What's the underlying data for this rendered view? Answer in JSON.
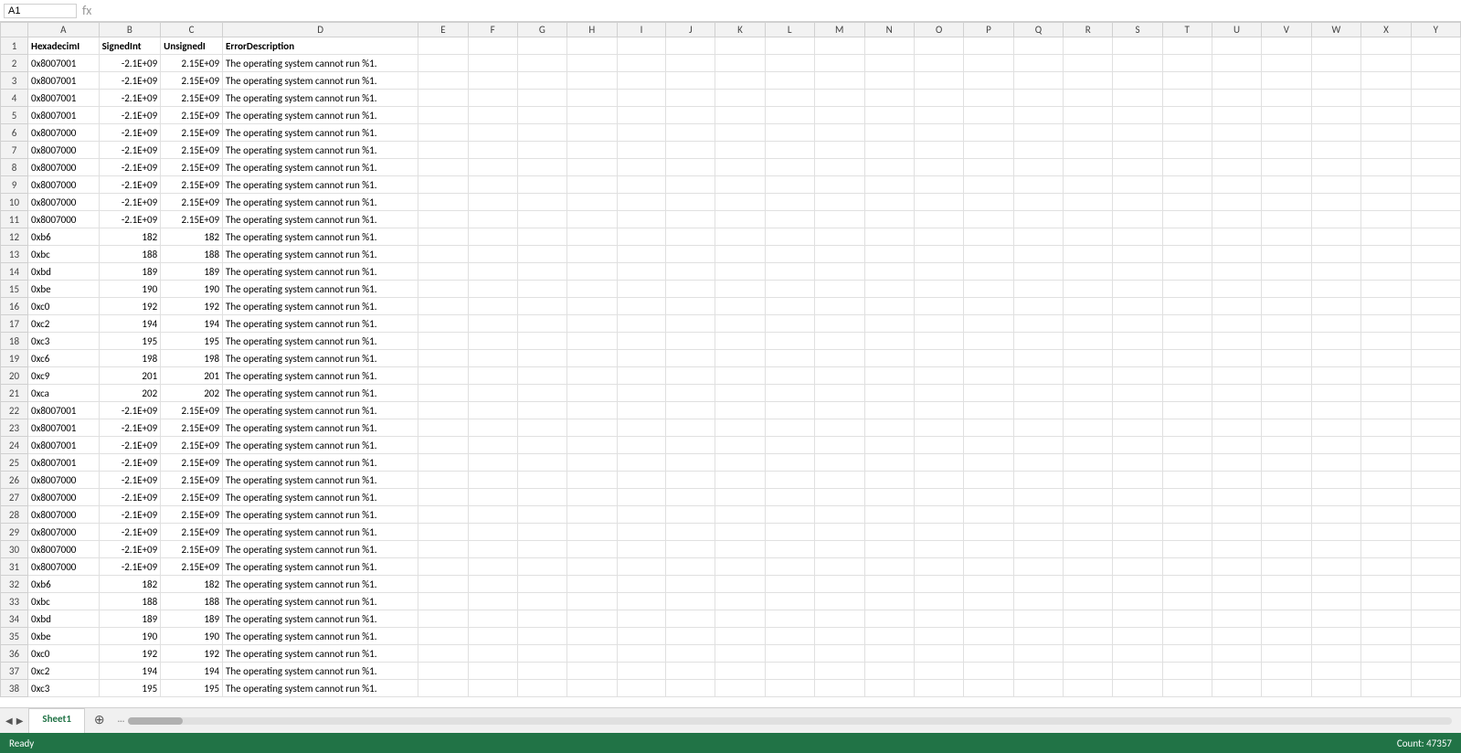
{
  "formula_bar": {
    "name_box": "A1",
    "formula_text": ""
  },
  "columns": [
    "A",
    "B",
    "C",
    "D",
    "E",
    "F",
    "G",
    "H",
    "I",
    "J",
    "K",
    "L",
    "M",
    "N",
    "O",
    "P",
    "Q",
    "R",
    "S",
    "T",
    "U",
    "V",
    "W",
    "X",
    "Y"
  ],
  "col_widths": {
    "A": 80,
    "B": 70,
    "C": 70,
    "D": 220,
    "E": 60,
    "F": 60,
    "G": 60
  },
  "header_row": [
    "HexadecimI",
    "SignedInt",
    "UnsignedI",
    "ErrorDescription",
    "",
    "",
    "",
    "",
    "",
    "",
    "",
    "",
    "",
    "",
    "",
    "",
    "",
    "",
    "",
    "",
    "",
    "",
    "",
    "",
    ""
  ],
  "rows": [
    {
      "num": 2,
      "a": "0x8007001",
      "b": "-2.1E+09",
      "c": "2.15E+09",
      "d": "The operating system cannot run %1.",
      "highlight": false
    },
    {
      "num": 3,
      "a": "0x8007001",
      "b": "-2.1E+09",
      "c": "2.15E+09",
      "d": "The operating system cannot run %1.",
      "highlight": false
    },
    {
      "num": 4,
      "a": "0x8007001",
      "b": "-2.1E+09",
      "c": "2.15E+09",
      "d": "The operating system cannot run %1.",
      "highlight": false
    },
    {
      "num": 5,
      "a": "0x8007001",
      "b": "-2.1E+09",
      "c": "2.15E+09",
      "d": "The operating system cannot run %1.",
      "highlight": false
    },
    {
      "num": 6,
      "a": "0x8007000",
      "b": "-2.1E+09",
      "c": "2.15E+09",
      "d": "The operating system cannot run %1.",
      "highlight": false
    },
    {
      "num": 7,
      "a": "0x8007000",
      "b": "-2.1E+09",
      "c": "2.15E+09",
      "d": "The operating system cannot run %1.",
      "highlight": false
    },
    {
      "num": 8,
      "a": "0x8007000",
      "b": "-2.1E+09",
      "c": "2.15E+09",
      "d": "The operating system cannot run %1.",
      "highlight": false
    },
    {
      "num": 9,
      "a": "0x8007000",
      "b": "-2.1E+09",
      "c": "2.15E+09",
      "d": "The operating system cannot run %1.",
      "highlight": false
    },
    {
      "num": 10,
      "a": "0x8007000",
      "b": "-2.1E+09",
      "c": "2.15E+09",
      "d": "The operating system cannot run %1.",
      "highlight": false
    },
    {
      "num": 11,
      "a": "0x8007000",
      "b": "-2.1E+09",
      "c": "2.15E+09",
      "d": "The operating system cannot run %1.",
      "highlight": false
    },
    {
      "num": 12,
      "a": "0xb6",
      "b": "182",
      "c": "182",
      "d": "The operating system cannot run %1.",
      "highlight": false
    },
    {
      "num": 13,
      "a": "0xbc",
      "b": "188",
      "c": "188",
      "d": "The operating system cannot run %1.",
      "highlight": false
    },
    {
      "num": 14,
      "a": "0xbd",
      "b": "189",
      "c": "189",
      "d": "The operating system cannot run %1.",
      "highlight": false
    },
    {
      "num": 15,
      "a": "0xbe",
      "b": "190",
      "c": "190",
      "d": "The operating system cannot run %1.",
      "highlight": false
    },
    {
      "num": 16,
      "a": "0xc0",
      "b": "192",
      "c": "192",
      "d": "The operating system cannot run %1.",
      "highlight": false
    },
    {
      "num": 17,
      "a": "0xc2",
      "b": "194",
      "c": "194",
      "d": "The operating system cannot run %1.",
      "highlight": false
    },
    {
      "num": 18,
      "a": "0xc3",
      "b": "195",
      "c": "195",
      "d": "The operating system cannot run %1.",
      "highlight": false
    },
    {
      "num": 19,
      "a": "0xc6",
      "b": "198",
      "c": "198",
      "d": "The operating system cannot run %1.",
      "highlight": false
    },
    {
      "num": 20,
      "a": "0xc9",
      "b": "201",
      "c": "201",
      "d": "The operating system cannot run %1.",
      "highlight": false
    },
    {
      "num": 21,
      "a": "0xca",
      "b": "202",
      "c": "202",
      "d": "The operating system cannot run %1.",
      "highlight": false
    },
    {
      "num": 22,
      "a": "0x8007001",
      "b": "-2.1E+09",
      "c": "2.15E+09",
      "d": "The operating system cannot run %1.",
      "highlight": false
    },
    {
      "num": 23,
      "a": "0x8007001",
      "b": "-2.1E+09",
      "c": "2.15E+09",
      "d": "The operating system cannot run %1.",
      "highlight": false
    },
    {
      "num": 24,
      "a": "0x8007001",
      "b": "-2.1E+09",
      "c": "2.15E+09",
      "d": "The operating system cannot run %1.",
      "highlight": false
    },
    {
      "num": 25,
      "a": "0x8007001",
      "b": "-2.1E+09",
      "c": "2.15E+09",
      "d": "The operating system cannot run %1.",
      "highlight": false
    },
    {
      "num": 26,
      "a": "0x8007000",
      "b": "-2.1E+09",
      "c": "2.15E+09",
      "d": "The operating system cannot run %1.",
      "highlight": false
    },
    {
      "num": 27,
      "a": "0x8007000",
      "b": "-2.1E+09",
      "c": "2.15E+09",
      "d": "The operating system cannot run %1.",
      "highlight": false
    },
    {
      "num": 28,
      "a": "0x8007000",
      "b": "-2.1E+09",
      "c": "2.15E+09",
      "d": "The operating system cannot run %1.",
      "highlight": false
    },
    {
      "num": 29,
      "a": "0x8007000",
      "b": "-2.1E+09",
      "c": "2.15E+09",
      "d": "The operating system cannot run %1.",
      "highlight": false
    },
    {
      "num": 30,
      "a": "0x8007000",
      "b": "-2.1E+09",
      "c": "2.15E+09",
      "d": "The operating system cannot run %1.",
      "highlight": false
    },
    {
      "num": 31,
      "a": "0x8007000",
      "b": "-2.1E+09",
      "c": "2.15E+09",
      "d": "The operating system cannot run %1.",
      "highlight": false
    },
    {
      "num": 32,
      "a": "0xb6",
      "b": "182",
      "c": "182",
      "d": "The operating system cannot run %1.",
      "highlight": false
    },
    {
      "num": 33,
      "a": "0xbc",
      "b": "188",
      "c": "188",
      "d": "The operating system cannot run %1.",
      "highlight": false
    },
    {
      "num": 34,
      "a": "0xbd",
      "b": "189",
      "c": "189",
      "d": "The operating system cannot run %1.",
      "highlight": false
    },
    {
      "num": 35,
      "a": "0xbe",
      "b": "190",
      "c": "190",
      "d": "The operating system cannot run %1.",
      "highlight": false
    },
    {
      "num": 36,
      "a": "0xc0",
      "b": "192",
      "c": "192",
      "d": "The operating system cannot run %1.",
      "highlight": false
    },
    {
      "num": 37,
      "a": "0xc2",
      "b": "194",
      "c": "194",
      "d": "The operating system cannot run %1.",
      "highlight": false
    },
    {
      "num": 38,
      "a": "0xc3",
      "b": "195",
      "c": "195",
      "d": "The operating system cannot run %1.",
      "highlight": false
    }
  ],
  "sheet_tabs": [
    "Sheet1"
  ],
  "status": {
    "ready": "Ready",
    "count": "Count: 47357"
  },
  "scrollbar": {
    "dots": "···"
  }
}
